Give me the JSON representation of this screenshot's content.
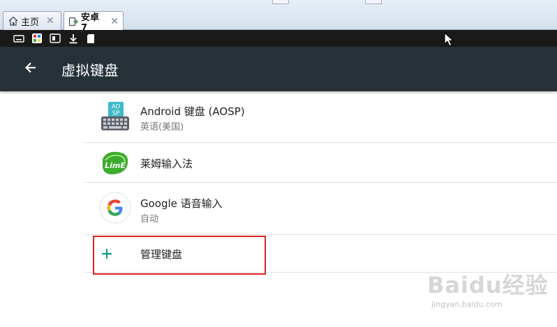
{
  "tabs": [
    {
      "label": "主页",
      "icon": "home-icon",
      "active": false
    },
    {
      "label": "安卓7",
      "icon": "android-device-icon",
      "active": true
    }
  ],
  "statusbar": {
    "icons": [
      "keyboard-icon",
      "app-notification-icon",
      "device-icon",
      "download-icon",
      "sd-card-icon"
    ]
  },
  "actionbar": {
    "back_icon": "arrow-left-icon",
    "title": "虚拟键盘"
  },
  "keyboards": [
    {
      "title": "Android 键盘 (AOSP)",
      "subtitle": "英语(美国)",
      "icon": "aosp-keyboard-icon",
      "icon_text": "AO SP"
    },
    {
      "title": "莱姆输入法",
      "subtitle": "",
      "icon": "lime-ime-icon",
      "icon_text": "LimE"
    },
    {
      "title": "Google 语音输入",
      "subtitle": "自动",
      "icon": "google-g-icon",
      "icon_text": ""
    }
  ],
  "manage": {
    "label": "管理键盘",
    "icon": "plus-icon"
  },
  "watermark": {
    "brand": "Baidu经验",
    "url": "jingyan.baidu.com"
  },
  "colors": {
    "actionbar": "#263238",
    "statusbar": "#1a1a1a",
    "accent_plus": "#009688",
    "highlight": "#e02020"
  }
}
